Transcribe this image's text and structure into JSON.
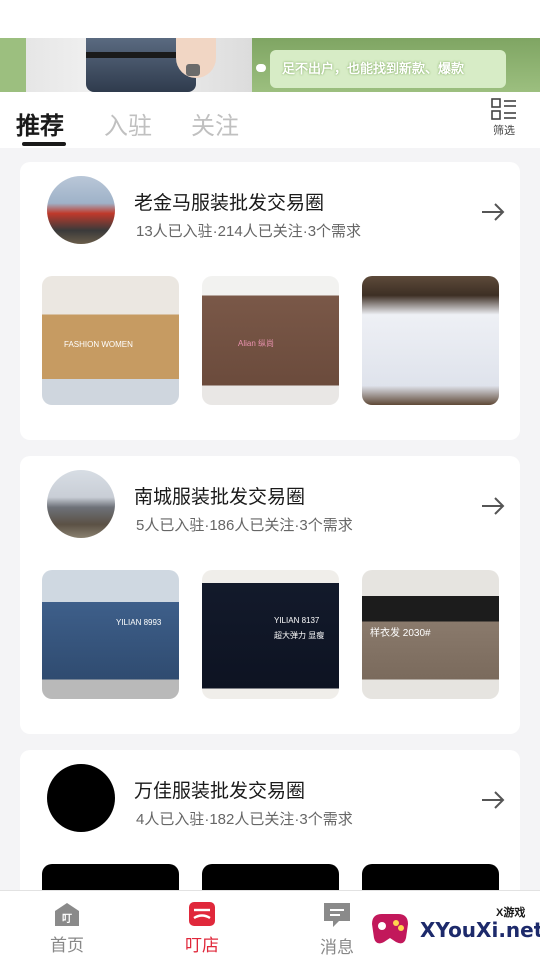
{
  "banner": {
    "slogan": "足不出户，也能找到新款、爆款"
  },
  "tabs": [
    {
      "label": "推荐",
      "active": true
    },
    {
      "label": "入驻",
      "active": false
    },
    {
      "label": "关注",
      "active": false
    }
  ],
  "filter": {
    "label": "筛选"
  },
  "circles": [
    {
      "name": "老金马服装批发交易圈",
      "stats": "13人已入驻·214人已关注·3个需求",
      "tags": [
        "FASHION WOMEN",
        "Alian 纵尚"
      ]
    },
    {
      "name": "南城服装批发交易圈",
      "stats": "5人已入驻·186人已关注·3个需求",
      "tags": [
        "YILIAN 8993",
        "YILIAN 8137",
        "超大弹力 显瘦",
        "样衣发 2030#"
      ]
    },
    {
      "name": "万佳服装批发交易圈",
      "stats": "4人已入驻·182人已关注·3个需求",
      "tags": []
    }
  ],
  "nav": [
    {
      "label": "首页",
      "icon": "home-icon",
      "active": false
    },
    {
      "label": "叮店",
      "icon": "shop-icon",
      "active": true
    },
    {
      "label": "消息",
      "icon": "message-icon",
      "active": false
    }
  ],
  "watermark": {
    "brand": "XYouXi.net",
    "cn": "X游戏"
  },
  "colors": {
    "accent": "#e0283b",
    "banner_green": "#9cbf7f"
  }
}
